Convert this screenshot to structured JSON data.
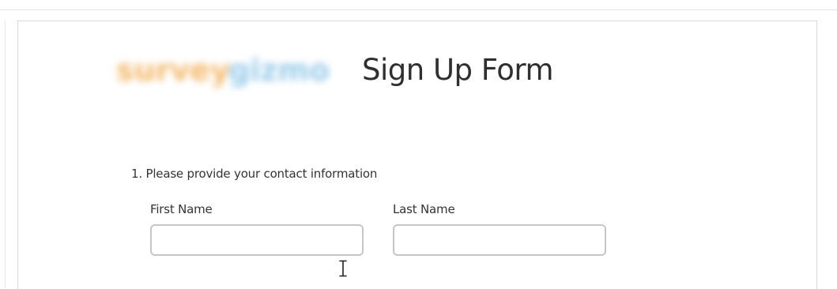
{
  "form": {
    "title": "Sign Up Form",
    "logo_text": "surveygizmo",
    "question": {
      "label": "1. Please provide your contact information",
      "fields": [
        {
          "label": "First Name",
          "value": ""
        },
        {
          "label": "Last Name",
          "value": ""
        }
      ]
    }
  },
  "cursor": "text-cursor-icon",
  "colors": {
    "logo_orange": "#f2b25c",
    "logo_blue": "#8ec6e8",
    "title": "#2f2f2f",
    "input_border": "#c6c6c6"
  }
}
